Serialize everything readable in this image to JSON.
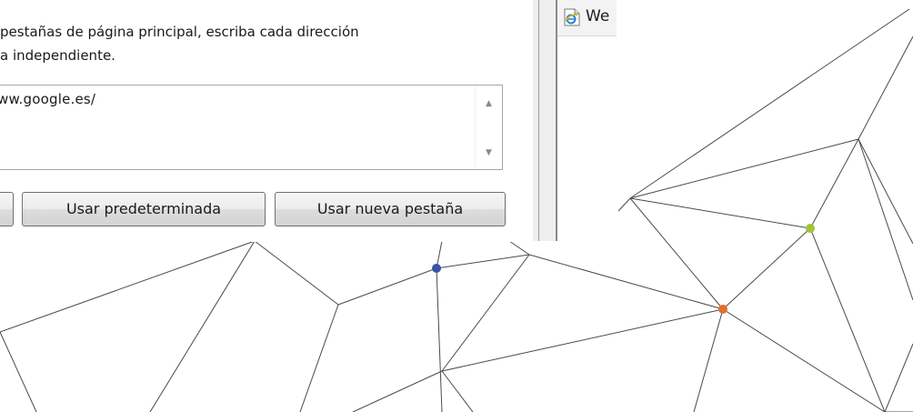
{
  "dialog": {
    "description_line1": "pestañas de página principal, escriba cada dirección",
    "description_line2": "a independiente.",
    "url_value": "ww.google.es/",
    "buttons": {
      "partial_label": "",
      "use_default_label": "Usar predeterminada",
      "use_new_tab_label": "Usar nueva pestaña"
    },
    "scroll_up_glyph": "▲",
    "scroll_down_glyph": "▼"
  },
  "window2": {
    "title": "We",
    "icon": "ie-page-icon"
  },
  "background": {
    "line_color": "#4a4a4a",
    "vertex_colors": {
      "blue": "#3a53a4",
      "green": "#a3c23a",
      "orange": "#e2702f"
    }
  }
}
